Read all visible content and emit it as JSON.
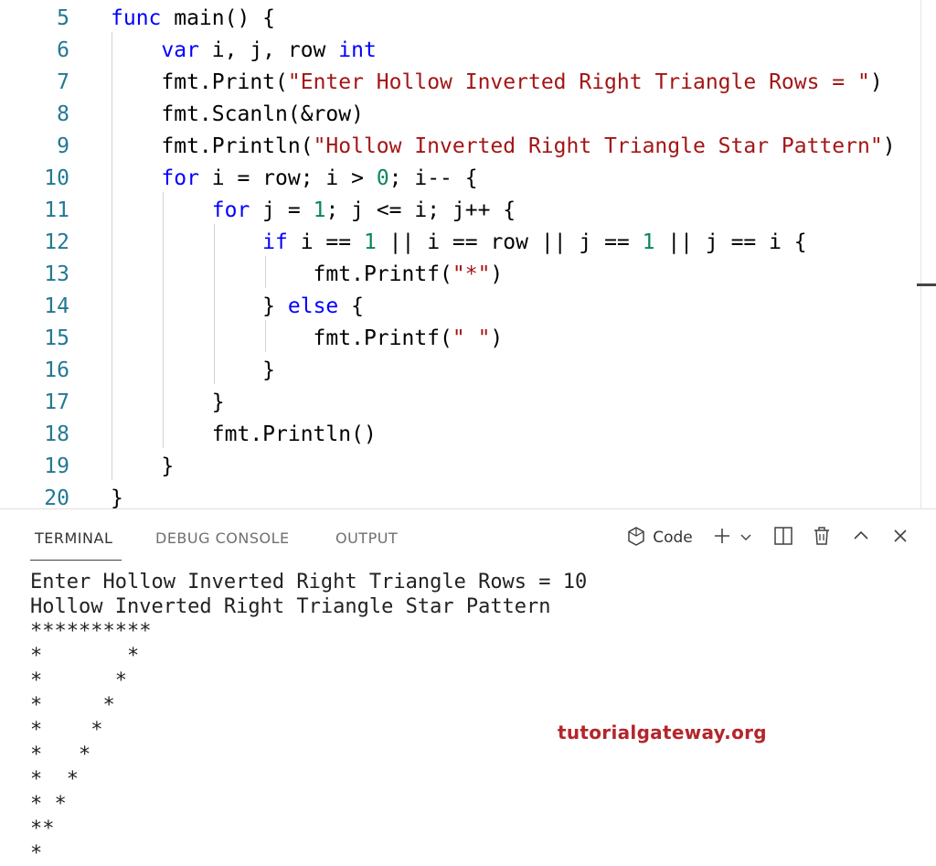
{
  "editor": {
    "lines": [
      {
        "num": "5",
        "tokens": [
          {
            "t": "func",
            "c": "kw"
          },
          {
            "t": " main() {",
            "c": ""
          }
        ]
      },
      {
        "num": "6",
        "tokens": [
          {
            "t": "    ",
            "c": ""
          },
          {
            "t": "var",
            "c": "kw"
          },
          {
            "t": " i, j, row ",
            "c": ""
          },
          {
            "t": "int",
            "c": "kw"
          }
        ]
      },
      {
        "num": "7",
        "tokens": [
          {
            "t": "    fmt.Print(",
            "c": ""
          },
          {
            "t": "\"Enter Hollow Inverted Right Triangle Rows = \"",
            "c": "str"
          },
          {
            "t": ")",
            "c": ""
          }
        ]
      },
      {
        "num": "8",
        "tokens": [
          {
            "t": "    fmt.Scanln(&row)",
            "c": ""
          }
        ]
      },
      {
        "num": "9",
        "tokens": [
          {
            "t": "    fmt.Println(",
            "c": ""
          },
          {
            "t": "\"Hollow Inverted Right Triangle Star Pattern\"",
            "c": "str"
          },
          {
            "t": ")",
            "c": ""
          }
        ]
      },
      {
        "num": "10",
        "tokens": [
          {
            "t": "    ",
            "c": ""
          },
          {
            "t": "for",
            "c": "kw"
          },
          {
            "t": " i = row; i > ",
            "c": ""
          },
          {
            "t": "0",
            "c": "num"
          },
          {
            "t": "; i-- {",
            "c": ""
          }
        ]
      },
      {
        "num": "11",
        "tokens": [
          {
            "t": "        ",
            "c": ""
          },
          {
            "t": "for",
            "c": "kw"
          },
          {
            "t": " j = ",
            "c": ""
          },
          {
            "t": "1",
            "c": "num"
          },
          {
            "t": "; j <= i; j++ {",
            "c": ""
          }
        ]
      },
      {
        "num": "12",
        "tokens": [
          {
            "t": "            ",
            "c": ""
          },
          {
            "t": "if",
            "c": "kw"
          },
          {
            "t": " i == ",
            "c": ""
          },
          {
            "t": "1",
            "c": "num"
          },
          {
            "t": " || i == row || j == ",
            "c": ""
          },
          {
            "t": "1",
            "c": "num"
          },
          {
            "t": " || j == i {",
            "c": ""
          }
        ]
      },
      {
        "num": "13",
        "tokens": [
          {
            "t": "                fmt.Printf(",
            "c": ""
          },
          {
            "t": "\"*\"",
            "c": "str"
          },
          {
            "t": ")",
            "c": ""
          }
        ]
      },
      {
        "num": "14",
        "tokens": [
          {
            "t": "            } ",
            "c": ""
          },
          {
            "t": "else",
            "c": "kw"
          },
          {
            "t": " {",
            "c": ""
          }
        ]
      },
      {
        "num": "15",
        "tokens": [
          {
            "t": "                fmt.Printf(",
            "c": ""
          },
          {
            "t": "\" \"",
            "c": "str"
          },
          {
            "t": ")",
            "c": ""
          }
        ]
      },
      {
        "num": "16",
        "tokens": [
          {
            "t": "            }",
            "c": ""
          }
        ]
      },
      {
        "num": "17",
        "tokens": [
          {
            "t": "        }",
            "c": ""
          }
        ]
      },
      {
        "num": "18",
        "tokens": [
          {
            "t": "        fmt.Println()",
            "c": ""
          }
        ]
      },
      {
        "num": "19",
        "tokens": [
          {
            "t": "    }",
            "c": ""
          }
        ]
      },
      {
        "num": "20",
        "tokens": [
          {
            "t": "}",
            "c": ""
          }
        ]
      }
    ]
  },
  "panel": {
    "tabs": [
      "TERMINAL",
      "DEBUG CONSOLE",
      "OUTPUT"
    ],
    "active_tab": "TERMINAL",
    "toolbar": {
      "shell_icon": "terminal-shell-icon",
      "shell_label": "Code",
      "add_icon": "plus-icon",
      "dropdown_icon": "chevron-down-icon",
      "split_icon": "split-icon",
      "trash_icon": "trash-icon",
      "maximize_icon": "chevron-up-icon",
      "close_icon": "close-icon"
    }
  },
  "terminal": {
    "lines": [
      "Enter Hollow Inverted Right Triangle Rows = 10",
      "Hollow Inverted Right Triangle Star Pattern",
      "**********",
      "*       *",
      "*      *",
      "*     *",
      "*    *",
      "*   *",
      "*  *",
      "* *",
      "**",
      "*"
    ]
  },
  "watermark": "tutorialgateway.org",
  "colors": {
    "keyword": "#0000ff",
    "string": "#a31515",
    "number": "#098658",
    "line_number": "#237893",
    "watermark": "#b3262b"
  }
}
